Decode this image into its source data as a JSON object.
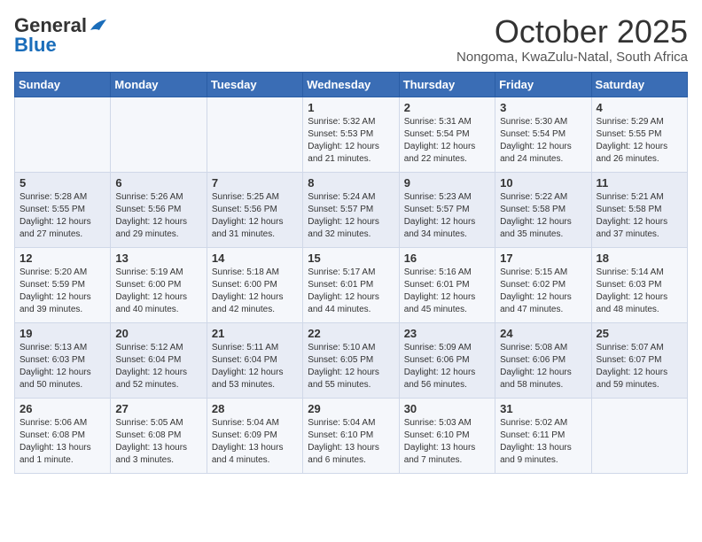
{
  "header": {
    "logo_general": "General",
    "logo_blue": "Blue",
    "month_title": "October 2025",
    "location": "Nongoma, KwaZulu-Natal, South Africa"
  },
  "days_of_week": [
    "Sunday",
    "Monday",
    "Tuesday",
    "Wednesday",
    "Thursday",
    "Friday",
    "Saturday"
  ],
  "weeks": [
    [
      {
        "day": "",
        "info": ""
      },
      {
        "day": "",
        "info": ""
      },
      {
        "day": "",
        "info": ""
      },
      {
        "day": "1",
        "info": "Sunrise: 5:32 AM\nSunset: 5:53 PM\nDaylight: 12 hours\nand 21 minutes."
      },
      {
        "day": "2",
        "info": "Sunrise: 5:31 AM\nSunset: 5:54 PM\nDaylight: 12 hours\nand 22 minutes."
      },
      {
        "day": "3",
        "info": "Sunrise: 5:30 AM\nSunset: 5:54 PM\nDaylight: 12 hours\nand 24 minutes."
      },
      {
        "day": "4",
        "info": "Sunrise: 5:29 AM\nSunset: 5:55 PM\nDaylight: 12 hours\nand 26 minutes."
      }
    ],
    [
      {
        "day": "5",
        "info": "Sunrise: 5:28 AM\nSunset: 5:55 PM\nDaylight: 12 hours\nand 27 minutes."
      },
      {
        "day": "6",
        "info": "Sunrise: 5:26 AM\nSunset: 5:56 PM\nDaylight: 12 hours\nand 29 minutes."
      },
      {
        "day": "7",
        "info": "Sunrise: 5:25 AM\nSunset: 5:56 PM\nDaylight: 12 hours\nand 31 minutes."
      },
      {
        "day": "8",
        "info": "Sunrise: 5:24 AM\nSunset: 5:57 PM\nDaylight: 12 hours\nand 32 minutes."
      },
      {
        "day": "9",
        "info": "Sunrise: 5:23 AM\nSunset: 5:57 PM\nDaylight: 12 hours\nand 34 minutes."
      },
      {
        "day": "10",
        "info": "Sunrise: 5:22 AM\nSunset: 5:58 PM\nDaylight: 12 hours\nand 35 minutes."
      },
      {
        "day": "11",
        "info": "Sunrise: 5:21 AM\nSunset: 5:58 PM\nDaylight: 12 hours\nand 37 minutes."
      }
    ],
    [
      {
        "day": "12",
        "info": "Sunrise: 5:20 AM\nSunset: 5:59 PM\nDaylight: 12 hours\nand 39 minutes."
      },
      {
        "day": "13",
        "info": "Sunrise: 5:19 AM\nSunset: 6:00 PM\nDaylight: 12 hours\nand 40 minutes."
      },
      {
        "day": "14",
        "info": "Sunrise: 5:18 AM\nSunset: 6:00 PM\nDaylight: 12 hours\nand 42 minutes."
      },
      {
        "day": "15",
        "info": "Sunrise: 5:17 AM\nSunset: 6:01 PM\nDaylight: 12 hours\nand 44 minutes."
      },
      {
        "day": "16",
        "info": "Sunrise: 5:16 AM\nSunset: 6:01 PM\nDaylight: 12 hours\nand 45 minutes."
      },
      {
        "day": "17",
        "info": "Sunrise: 5:15 AM\nSunset: 6:02 PM\nDaylight: 12 hours\nand 47 minutes."
      },
      {
        "day": "18",
        "info": "Sunrise: 5:14 AM\nSunset: 6:03 PM\nDaylight: 12 hours\nand 48 minutes."
      }
    ],
    [
      {
        "day": "19",
        "info": "Sunrise: 5:13 AM\nSunset: 6:03 PM\nDaylight: 12 hours\nand 50 minutes."
      },
      {
        "day": "20",
        "info": "Sunrise: 5:12 AM\nSunset: 6:04 PM\nDaylight: 12 hours\nand 52 minutes."
      },
      {
        "day": "21",
        "info": "Sunrise: 5:11 AM\nSunset: 6:04 PM\nDaylight: 12 hours\nand 53 minutes."
      },
      {
        "day": "22",
        "info": "Sunrise: 5:10 AM\nSunset: 6:05 PM\nDaylight: 12 hours\nand 55 minutes."
      },
      {
        "day": "23",
        "info": "Sunrise: 5:09 AM\nSunset: 6:06 PM\nDaylight: 12 hours\nand 56 minutes."
      },
      {
        "day": "24",
        "info": "Sunrise: 5:08 AM\nSunset: 6:06 PM\nDaylight: 12 hours\nand 58 minutes."
      },
      {
        "day": "25",
        "info": "Sunrise: 5:07 AM\nSunset: 6:07 PM\nDaylight: 12 hours\nand 59 minutes."
      }
    ],
    [
      {
        "day": "26",
        "info": "Sunrise: 5:06 AM\nSunset: 6:08 PM\nDaylight: 13 hours\nand 1 minute."
      },
      {
        "day": "27",
        "info": "Sunrise: 5:05 AM\nSunset: 6:08 PM\nDaylight: 13 hours\nand 3 minutes."
      },
      {
        "day": "28",
        "info": "Sunrise: 5:04 AM\nSunset: 6:09 PM\nDaylight: 13 hours\nand 4 minutes."
      },
      {
        "day": "29",
        "info": "Sunrise: 5:04 AM\nSunset: 6:10 PM\nDaylight: 13 hours\nand 6 minutes."
      },
      {
        "day": "30",
        "info": "Sunrise: 5:03 AM\nSunset: 6:10 PM\nDaylight: 13 hours\nand 7 minutes."
      },
      {
        "day": "31",
        "info": "Sunrise: 5:02 AM\nSunset: 6:11 PM\nDaylight: 13 hours\nand 9 minutes."
      },
      {
        "day": "",
        "info": ""
      }
    ]
  ]
}
